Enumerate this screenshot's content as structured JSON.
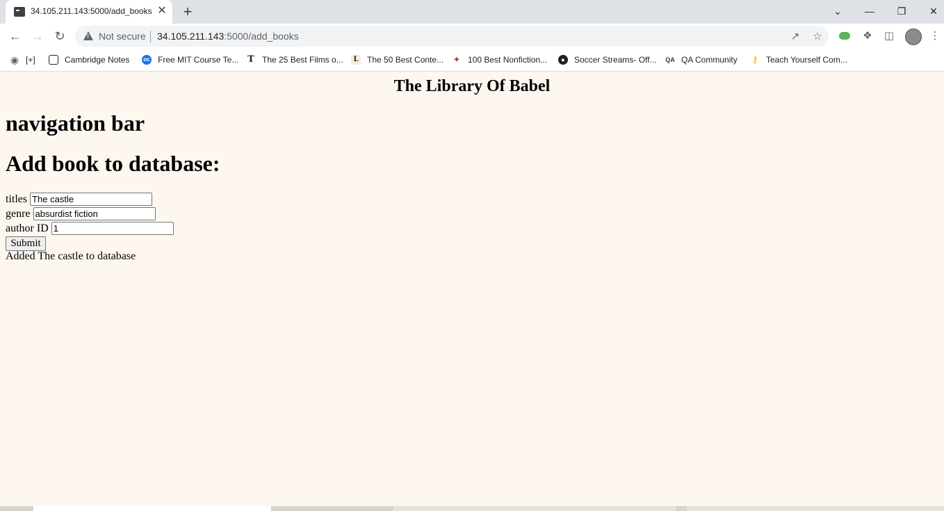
{
  "browser": {
    "tab_title": "34.105.211.143:5000/add_books",
    "tab_close": "✕",
    "new_tab": "+",
    "security_label": "Not secure",
    "url_host": "34.105.211.143",
    "url_path": ":5000/add_books",
    "window_controls": [
      "⌄",
      "—",
      "❐",
      "✕"
    ],
    "bookmarks": [
      {
        "label": "[+]",
        "icon": "globe-icon",
        "color": "#5f6368"
      },
      {
        "label": "Cambridge Notes",
        "icon": "cambridge-icon",
        "color": "#202124"
      },
      {
        "label": "Free MIT Course Te...",
        "icon": "oc-icon",
        "color": "#1a73e8"
      },
      {
        "label": "The 25 Best Films o...",
        "icon": "nyt-icon",
        "color": "#202124"
      },
      {
        "label": "The 50 Best Conte...",
        "icon": "l-icon",
        "color": "#5f4b2a"
      },
      {
        "label": "100 Best Nonfiction...",
        "icon": "pdf-icon",
        "color": "#d93025"
      },
      {
        "label": "Soccer Streams- Off...",
        "icon": "soccer-icon",
        "color": "#202124"
      },
      {
        "label": "QA Community",
        "icon": "qa-icon",
        "color": "#1b3a5c"
      },
      {
        "label": "Teach Yourself Com...",
        "icon": "key-icon",
        "color": "#f4b400"
      }
    ]
  },
  "page": {
    "site_title": "The Library Of Babel",
    "nav_heading": "navigation bar",
    "form_heading": "Add book to database:",
    "fields": [
      {
        "label": "titles",
        "value": "The castle"
      },
      {
        "label": "genre",
        "value": "absurdist fiction"
      },
      {
        "label": "author ID",
        "value": "1"
      }
    ],
    "submit_label": "Submit",
    "result_message": "Added The castle to database"
  }
}
